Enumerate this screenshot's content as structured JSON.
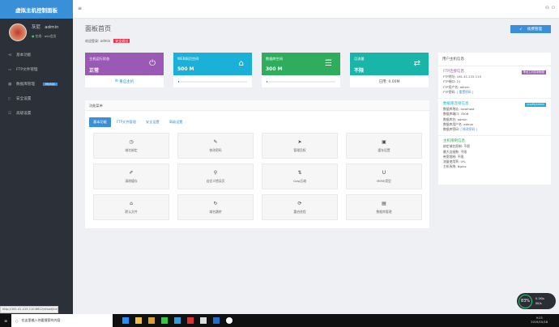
{
  "sidebar": {
    "brand": "虚拟主机控制面板",
    "user_name": "灰尼",
    "user_login": "admin",
    "user_status": "在线 · adv会员",
    "items": [
      {
        "icon": "≪",
        "label": "基本功能"
      },
      {
        "icon": "▭",
        "label": "FTP文件管理"
      },
      {
        "icon": "▦",
        "label": "数据库管理",
        "badge": "MySQL"
      },
      {
        "icon": "▯",
        "label": "安全设置"
      },
      {
        "icon": "☑",
        "label": "高级设置"
      }
    ]
  },
  "header": {
    "menu_icon": "≡"
  },
  "page": {
    "title": "面板首页",
    "welcome_label": "欢迎登录:",
    "welcome_user": "admin",
    "logout": "安全退出",
    "renew": "续费管理"
  },
  "cards": [
    {
      "label": "主机运行状态",
      "value": "正常",
      "icon": "⏻",
      "footer": "重启主机",
      "color": "#9b59b6"
    },
    {
      "label": "WEB网页空间",
      "value": "500 M",
      "icon": "⌂",
      "color": "#1ab0d8"
    },
    {
      "label": "数据库空间",
      "value": "300 M",
      "icon": "☰",
      "color": "#2eae5c"
    },
    {
      "label": "月流量",
      "value": "不限",
      "icon": "⇄",
      "footer": "已用: 0.00M",
      "color": "#19b5a8"
    }
  ],
  "functions": {
    "title": "功能菜单",
    "tabs": [
      "基本功能",
      "FTP文件管理",
      "安全设置",
      "高级设置"
    ],
    "items": [
      {
        "icon": "◷",
        "label": "域名绑定"
      },
      {
        "icon": "✎",
        "label": "修改密码"
      },
      {
        "icon": "➤",
        "label": "管理员权"
      },
      {
        "icon": "▣",
        "label": "缓存设置"
      },
      {
        "icon": "✐",
        "label": "清除缓存"
      },
      {
        "icon": "⚲",
        "label": "自定义错误页"
      },
      {
        "icon": "⇅",
        "label": "Gzip压缩"
      },
      {
        "icon": "U",
        "label": "MIME类型"
      },
      {
        "icon": "⌂",
        "label": "默认文件"
      },
      {
        "icon": "↻",
        "label": "域名跳转"
      },
      {
        "icon": "⟳",
        "label": "重启进程"
      },
      {
        "icon": "▤",
        "label": "数据库管理"
      }
    ]
  },
  "info": {
    "title": "用户主机信息",
    "ftp": {
      "title": "FTP连接信息",
      "badge": "神龙主机控制面板",
      "addr": "FTP地址: 161.41.215.110",
      "port": "FTP端口: 21",
      "user": "FTP用户名: admin",
      "pass": "FTP密码:",
      "pass_link": "[ 重置密码 ]"
    },
    "db": {
      "title": "数据库连接信息",
      "badge": "phpMyAdmin",
      "addr": "数据库地址: localhost",
      "port": "数据库端口: 3306",
      "name": "数据库名: admin",
      "user": "数据库用户名: admin",
      "pass": "数据库密码:",
      "pass_link": "[ 修改密码 ]"
    },
    "limit": {
      "title": "主机限制信息",
      "l1": "绑定域名限制: 不限",
      "l2": "最大连接数: 不限",
      "l3": "带宽限制: 不限",
      "l4": "流量使用率: 0%",
      "l5": "主机系统: Nginx"
    }
  },
  "status_url": "http://161.41.215.110:8812/vhost/index.php?c=",
  "widget": {
    "percent": "83%",
    "up": "0.1K/s",
    "down": "0K/s"
  },
  "taskbar": {
    "search": "在这里输入你要搜索的内容",
    "time": "9:23",
    "date": "2019/10/18"
  }
}
